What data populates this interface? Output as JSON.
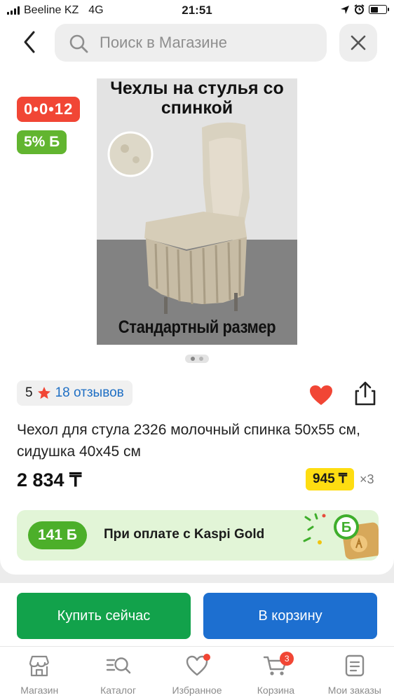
{
  "status_bar": {
    "carrier": "Beeline KZ",
    "network": "4G",
    "time": "21:51",
    "battery_level": 0.5
  },
  "search": {
    "placeholder": "Поиск в Магазине",
    "icons": {
      "back": "chevron-left-icon",
      "search": "search-icon",
      "close": "close-icon"
    }
  },
  "product": {
    "timer_badge": "0•0•12",
    "bonus_badge": "5% Б",
    "image": {
      "title": "Чехлы на стулья со спинкой",
      "caption": "Стандартный размер",
      "page_count": 2,
      "active_page": 1
    },
    "rating": "5",
    "reviews": "18 отзывов",
    "favorited": true,
    "title": "Чехол для стула 2326 молочный спинка 50x55 см, сидушка 40x45 см",
    "price": "2 834 ₸",
    "installment": {
      "amount": "945 ₸",
      "months": "×3"
    },
    "gold_banner": {
      "bonus": "141 Б",
      "text": "При оплате с Kaspi Gold"
    }
  },
  "actions": {
    "buy_now": "Купить сейчас",
    "add_to_cart": "В корзину"
  },
  "tabbar": {
    "items": [
      {
        "label": "Магазин",
        "icon": "store-icon"
      },
      {
        "label": "Каталог",
        "icon": "catalog-search-icon"
      },
      {
        "label": "Избранное",
        "icon": "heart-outline-icon",
        "dot": true
      },
      {
        "label": "Корзина",
        "icon": "cart-icon",
        "badge": "3"
      },
      {
        "label": "Мои заказы",
        "icon": "orders-icon"
      }
    ]
  },
  "colors": {
    "timer_red": "#f14635",
    "bonus_green": "#62b530",
    "buy_green": "#12a24b",
    "cart_blue": "#1d6fd0",
    "installment_yellow": "#fedd11",
    "link_blue": "#1f6fc4"
  }
}
